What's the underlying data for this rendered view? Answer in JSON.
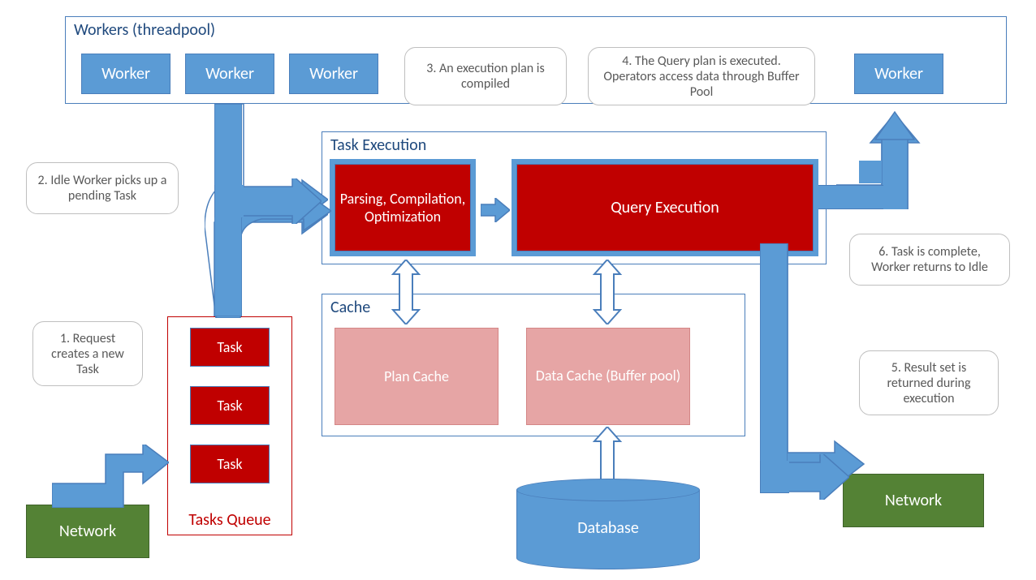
{
  "workers_panel": {
    "title": "Workers (threadpool)"
  },
  "worker_boxes": {
    "w1": "Worker",
    "w2": "Worker",
    "w3": "Worker",
    "w4": "Worker"
  },
  "task_exec_panel": {
    "title": "Task Execution"
  },
  "parsing_box": "Parsing, Compilation, Optimization",
  "query_exec_box": "Query Execution",
  "cache_panel": {
    "title": "Cache"
  },
  "plan_cache": "Plan Cache",
  "data_cache": "Data Cache (Buffer pool)",
  "database": "Database",
  "network_left": "Network",
  "network_right": "Network",
  "tasks_queue_label": "Tasks Queue",
  "task_items": {
    "t1": "Task",
    "t2": "Task",
    "t3": "Task"
  },
  "callouts": {
    "c1": "1. Request creates a new Task",
    "c2": "2. Idle Worker picks up a pending Task",
    "c3": "3. An execution plan is compiled",
    "c4": "4. The Query plan is executed. Operators access data through Buffer Pool",
    "c5": "5. Result set is returned during execution",
    "c6": "6. Task is complete, Worker returns to Idle"
  }
}
